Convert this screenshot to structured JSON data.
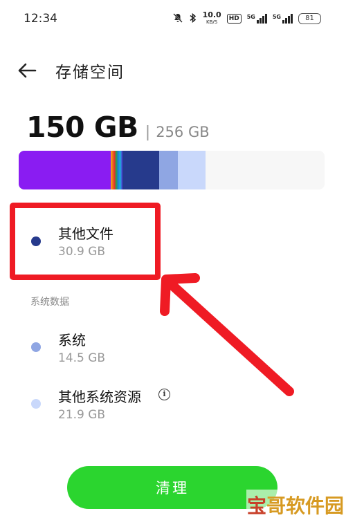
{
  "status_bar": {
    "time": "12:34",
    "net_speed": "10.0",
    "net_unit": "KB/S",
    "hd": "HD",
    "sim1_label": "5G",
    "sim2_label": "5G",
    "battery": "81"
  },
  "header": {
    "title": "存储空间"
  },
  "usage": {
    "used": "150 GB",
    "separator": "|",
    "total": "256 GB",
    "used_fraction": 0.586
  },
  "storage_bar": {
    "segments": [
      {
        "name": "apps",
        "fraction": 0.3,
        "color": "#8a1cf2"
      },
      {
        "name": "media",
        "fraction": 0.04,
        "color": "multicolor"
      },
      {
        "name": "other-files",
        "fraction": 0.12,
        "color": "#263a8c"
      },
      {
        "name": "system",
        "fraction": 0.06,
        "color": "#8fa6e3"
      },
      {
        "name": "other-system-resources",
        "fraction": 0.09,
        "color": "#c9d8fb"
      }
    ]
  },
  "items": {
    "other_files": {
      "title": "其他文件",
      "size": "30.9 GB",
      "color": "#263a8c"
    },
    "section_label": "系统数据",
    "system": {
      "title": "系统",
      "size": "14.5 GB",
      "color": "#8fa6e3"
    },
    "other_system": {
      "title": "其他系统资源",
      "size": "21.9 GB",
      "color": "#c9d8fb",
      "info_icon": "i"
    }
  },
  "clean_button": {
    "label": "清理"
  },
  "watermark": {
    "text_a": "宝",
    "text_b": "哥软件园"
  },
  "annotation": {
    "color": "#ef1b24"
  }
}
